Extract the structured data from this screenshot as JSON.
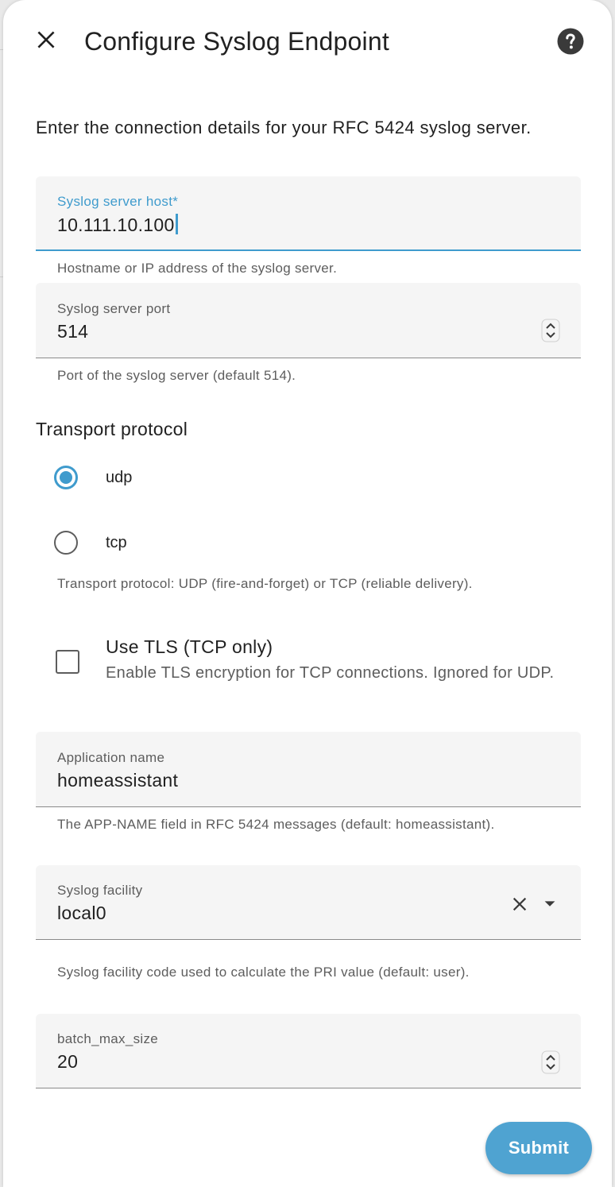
{
  "dialog": {
    "title": "Configure Syslog Endpoint",
    "description": "Enter the connection details for your RFC 5424 syslog server."
  },
  "host": {
    "label": "Syslog server host*",
    "value": "10.111.10.100",
    "helper": "Hostname or IP address of the syslog server."
  },
  "port": {
    "label": "Syslog server port",
    "value": "514",
    "helper": "Port of the syslog server (default 514)."
  },
  "protocol": {
    "title": "Transport protocol",
    "options": [
      {
        "label": "udp",
        "checked": true
      },
      {
        "label": "tcp",
        "checked": false
      }
    ],
    "helper": "Transport protocol: UDP (fire-and-forget) or TCP (reliable delivery)."
  },
  "tls": {
    "title": "Use TLS (TCP only)",
    "description": "Enable TLS encryption for TCP connections. Ignored for UDP.",
    "checked": false
  },
  "app_name": {
    "label": "Application name",
    "value": "homeassistant",
    "helper": "The APP-NAME field in RFC 5424 messages (default: homeassistant)."
  },
  "facility": {
    "label": "Syslog facility",
    "value": "local0",
    "helper": "Syslog facility code used to calculate the PRI value (default: user)."
  },
  "batch": {
    "label": "batch_max_size",
    "value": "20"
  },
  "actions": {
    "submit_label": "Submit"
  },
  "colors": {
    "accent": "#3f9bcd",
    "button": "#4fa3d1",
    "field_bg": "#f5f5f5"
  },
  "icons": {
    "close": "close-icon",
    "help": "help-circle-icon",
    "stepper": "unfold-icon",
    "clear": "clear-icon",
    "dropdown": "arrow-drop-down-icon"
  }
}
